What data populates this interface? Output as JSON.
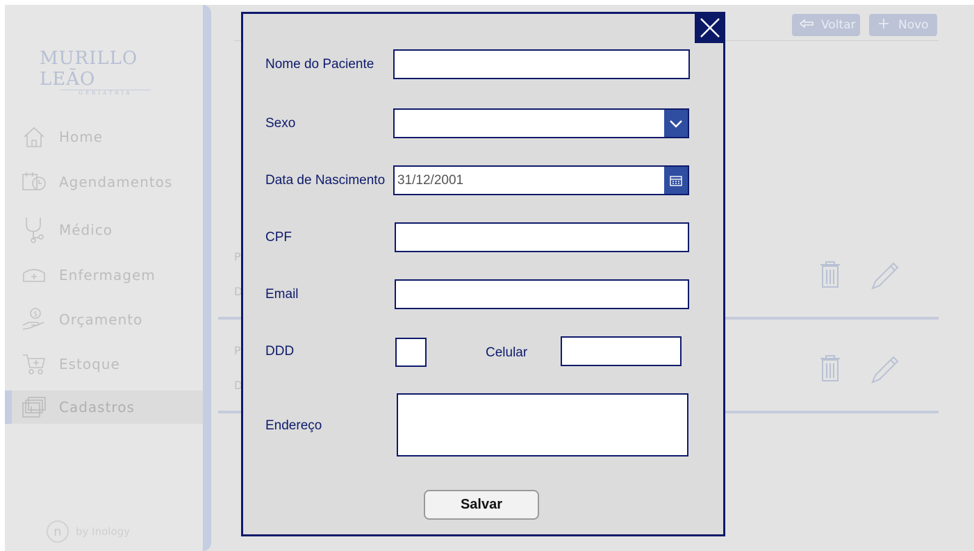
{
  "sidebar": {
    "logo": {
      "main": "MURILLO LEÃO",
      "sub": "GERIATRIA"
    },
    "items": [
      {
        "label": "Home",
        "icon": "home-icon"
      },
      {
        "label": "Agendamentos",
        "icon": "calendar-clock-icon"
      },
      {
        "label": "Médico",
        "icon": "stethoscope-icon"
      },
      {
        "label": "Enfermagem",
        "icon": "nurse-cap-icon"
      },
      {
        "label": "Orçamento",
        "icon": "money-hand-icon"
      },
      {
        "label": "Estoque",
        "icon": "cart-icon"
      },
      {
        "label": "Cadastros",
        "icon": "folders-icon"
      }
    ],
    "active_item": "Cadastros",
    "footer": "by Inology"
  },
  "topbar": {
    "back_label": "Voltar",
    "new_label": "Novo"
  },
  "background_rows": [
    {
      "p": "P",
      "d": "D"
    },
    {
      "p": "P",
      "d": "D"
    }
  ],
  "modal": {
    "fields": {
      "nome_label": "Nome do Paciente",
      "nome_value": "",
      "sexo_label": "Sexo",
      "sexo_value": "",
      "nascimento_label": "Data de Nascimento",
      "nascimento_value": "31/12/2001",
      "cpf_label": "CPF",
      "cpf_value": "",
      "email_label": "Email",
      "email_value": "",
      "ddd_label": "DDD",
      "ddd_value": "",
      "celular_label": "Celular",
      "celular_value": "",
      "endereco_label": "Endereço",
      "endereco_value": ""
    },
    "save_label": "Salvar"
  },
  "colors": {
    "accent": "#0e1a6b",
    "button_blue": "#2f4ea2",
    "sidebar_edge": "#c5cde2"
  }
}
